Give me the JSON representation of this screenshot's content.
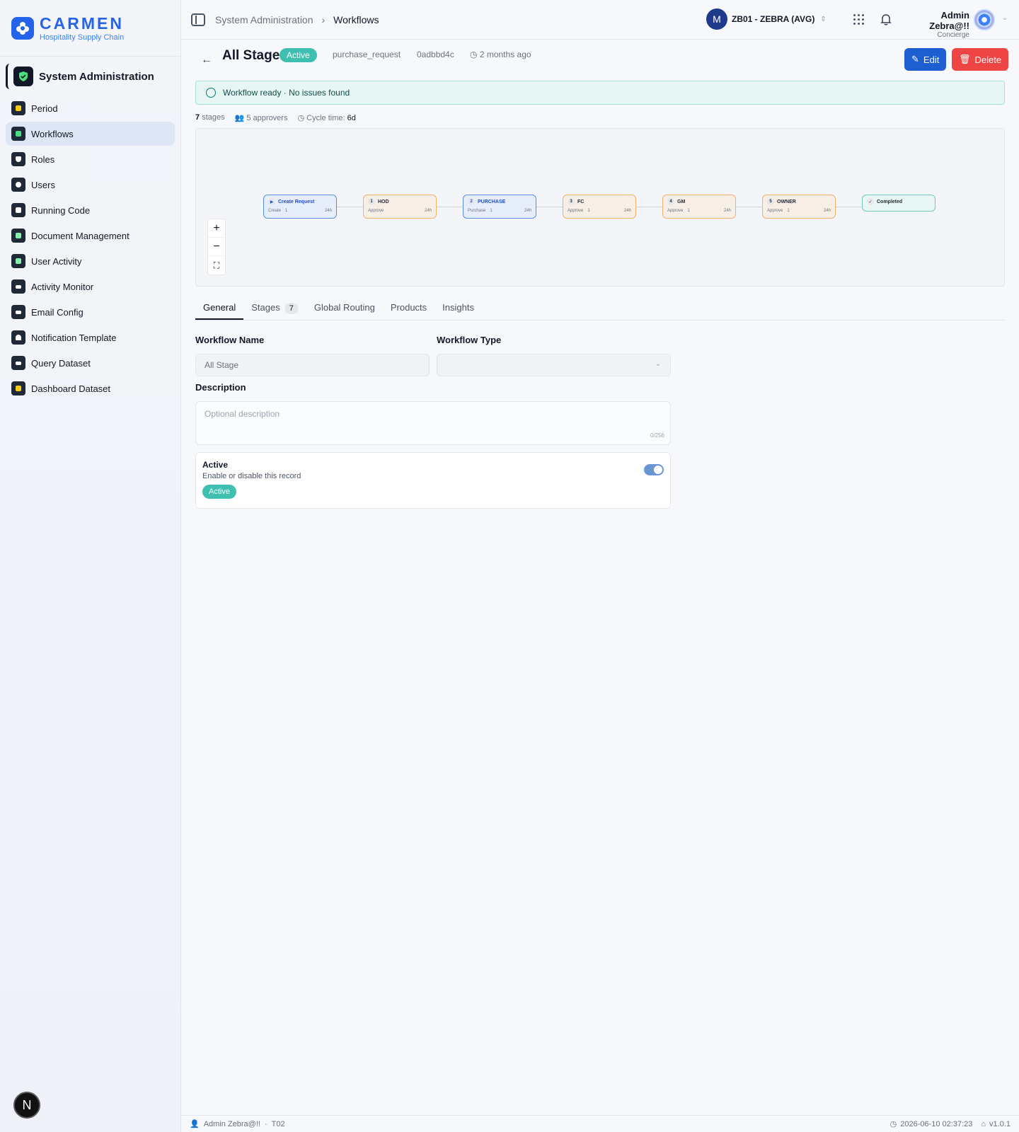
{
  "brand": {
    "name": "CARMEN",
    "subtitle": "Hospitality Supply Chain"
  },
  "sidebar": {
    "section": "System Administration",
    "items": [
      {
        "label": "Period",
        "icon": "calendar-icon",
        "color": "#facc15"
      },
      {
        "label": "Workflows",
        "icon": "workflow-icon",
        "color": "#4ade80",
        "active": true
      },
      {
        "label": "Roles",
        "icon": "shield-icon",
        "color": "#ffffff"
      },
      {
        "label": "Users",
        "icon": "user-icon",
        "color": "#ffffff"
      },
      {
        "label": "Running Code",
        "icon": "document-code-icon",
        "color": "#ffffff"
      },
      {
        "label": "Document Management",
        "icon": "document-icon",
        "color": "#86efac"
      },
      {
        "label": "User Activity",
        "icon": "user-activity-icon",
        "color": "#86efac"
      },
      {
        "label": "Activity Monitor",
        "icon": "monitor-icon",
        "color": "#ffffff"
      },
      {
        "label": "Email Config",
        "icon": "mail-icon",
        "color": "#ffffff"
      },
      {
        "label": "Notification Template",
        "icon": "bell-icon",
        "color": "#ffffff"
      },
      {
        "label": "Query Dataset",
        "icon": "table-icon",
        "color": "#ffffff"
      },
      {
        "label": "Dashboard Dataset",
        "icon": "dashboard-icon",
        "color": "#facc15"
      }
    ],
    "fab_label": "N"
  },
  "header": {
    "breadcrumb": [
      "System Administration",
      "Workflows"
    ],
    "tenant": "ZB01 - ZEBRA (AVG)",
    "user_name": "Admin Zebra@!!",
    "user_role": "Concierge"
  },
  "workflow": {
    "title": "All Stage",
    "status": "Active",
    "type_key": "purchase_request",
    "id": "0adbbd4c",
    "updated": "2 months ago",
    "edit_label": "Edit",
    "delete_label": "Delete",
    "banner": "Workflow ready · No issues found",
    "stats": {
      "stages_count": "7",
      "stages_label": "stages",
      "approvers": "5 approvers",
      "cycle_label": "Cycle time:",
      "cycle_value": "6d"
    }
  },
  "diagram": {
    "nodes": [
      {
        "num": "▶",
        "name": "Create Request",
        "action": "Create",
        "approvers": "1",
        "sla": "24h",
        "style": "blue"
      },
      {
        "num": "1",
        "name": "HOD",
        "action": "Approve",
        "approvers": "",
        "sla": "24h",
        "style": "orange"
      },
      {
        "num": "2",
        "name": "PURCHASE",
        "action": "Purchase",
        "approvers": "1",
        "sla": "24h",
        "style": "blue"
      },
      {
        "num": "3",
        "name": "FC",
        "action": "Approve",
        "approvers": "1",
        "sla": "24h",
        "style": "orange"
      },
      {
        "num": "4",
        "name": "GM",
        "action": "Approve",
        "approvers": "1",
        "sla": "24h",
        "style": "orange"
      },
      {
        "num": "5",
        "name": "OWNER",
        "action": "Approve",
        "approvers": "1",
        "sla": "24h",
        "style": "orange"
      },
      {
        "num": "✓",
        "name": "Completed",
        "action": "",
        "approvers": "",
        "sla": "",
        "style": "teal"
      }
    ]
  },
  "tabs": [
    {
      "label": "General",
      "active": true
    },
    {
      "label": "Stages",
      "count": "7"
    },
    {
      "label": "Global Routing"
    },
    {
      "label": "Products"
    },
    {
      "label": "Insights"
    }
  ],
  "form": {
    "name_label": "Workflow Name",
    "name_value": "All Stage",
    "type_label": "Workflow Type",
    "type_value": "",
    "desc_label": "Description",
    "desc_placeholder": "Optional description",
    "desc_counter": "0/256",
    "active_title": "Active",
    "active_sub": "Enable or disable this record",
    "active_badge": "Active"
  },
  "footer": {
    "user": "Admin Zebra@!!",
    "code": "T02",
    "datetime": "2026-06-10 02:37:23",
    "version": "v1.0.1"
  },
  "colors": {
    "accent": "#2563eb",
    "active": "#3ebfb0",
    "danger": "#ef4444"
  }
}
